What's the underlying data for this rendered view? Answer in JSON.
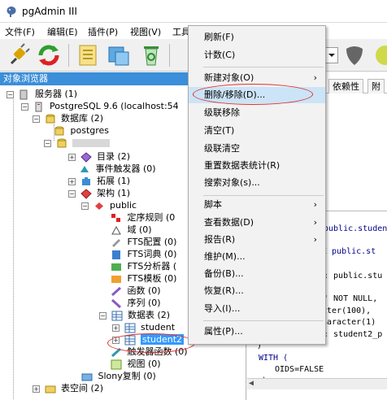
{
  "window": {
    "title": "pgAdmin III"
  },
  "menubar": {
    "items": [
      "文件(F)",
      "编辑(E)",
      "插件(P)",
      "视图(V)",
      "工具"
    ]
  },
  "object_browser": {
    "header": "对象浏览器",
    "nodes": {
      "servers": "服务器 (1)",
      "server": "PostgreSQL 9.6 (localhost:54",
      "databases": "数据库 (2)",
      "db_postgres": "postgres",
      "catalogs": "目录 (2)",
      "event_triggers": "事件触发器 (0)",
      "extensions": "拓展 (1)",
      "schemas": "架构 (1)",
      "public": "public",
      "collations": "定序规则 (0",
      "domains": "域 (0)",
      "fts_config": "FTS配置 (0)",
      "fts_dict": "FTS词典 (0)",
      "fts_parser": "FTS分析器 (",
      "fts_template": "FTS模板 (0)",
      "functions": "函数 (0)",
      "sequences": "序列 (0)",
      "tables": "数据表 (2)",
      "student": "student",
      "student2": "student2",
      "trigger_funcs": "触发器函数 (0)",
      "views": "视图 (0)",
      "slony": "Slony复制 (0)",
      "tablespaces": "表空间 (2)"
    }
  },
  "right_pane": {
    "tabs": [
      "依赖性",
      "附"
    ],
    "sql_lines": [
      "public.studen",
      "E public.st",
      ": public.stu",
      "' NOT NULL,",
      "cter(100),",
      "haracter(1)",
      ": student2_p",
      ")",
      "WITH (",
      "OIDS=FALSE",
      ");"
    ]
  },
  "context_menu": {
    "items": [
      {
        "label": "刷新(F)"
      },
      {
        "label": "计数(C)"
      },
      {
        "label": "新建对象(O)",
        "submenu": true
      },
      {
        "label": "删除/移除(D)...",
        "highlighted": true
      },
      {
        "label": "级联移除"
      },
      {
        "label": "清空(T)"
      },
      {
        "label": "级联清空"
      },
      {
        "label": "重置数据表统计(R)"
      },
      {
        "label": "搜索对象(s)..."
      },
      {
        "label": "脚本",
        "submenu": true
      },
      {
        "label": "查看数据(D)",
        "submenu": true
      },
      {
        "label": "报告(R)",
        "submenu": true
      },
      {
        "label": "维护(M)..."
      },
      {
        "label": "备份(B)..."
      },
      {
        "label": "恢复(R)..."
      },
      {
        "label": "导入(I)..."
      },
      {
        "label": "属性(P)..."
      }
    ],
    "submenu_arrow": "›"
  },
  "colors": {
    "selection": "#3399ff",
    "annotation": "#e0302f",
    "header": "#3b8ed9"
  }
}
